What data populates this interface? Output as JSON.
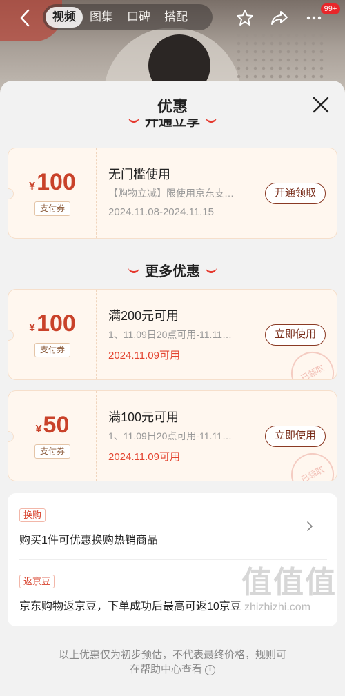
{
  "top_nav": {
    "tabs": [
      "视频",
      "图集",
      "口碑",
      "搭配"
    ],
    "active_tab": "视频",
    "badge": "99+"
  },
  "sheet": {
    "title": "优惠",
    "section_partial": "开通立享",
    "section_more": "更多优惠"
  },
  "coupons": [
    {
      "yen": "¥",
      "amount": "100",
      "type": "支付券",
      "title": "无门槛使用",
      "desc": "【购物立减】限使用京东支…",
      "date": "2024.11.08-2024.11.15",
      "button": "开通领取",
      "stamp": ""
    },
    {
      "yen": "¥",
      "amount": "100",
      "type": "支付券",
      "title": "满200元可用",
      "desc": "1、11.09日20点可用-11.11…",
      "date": "2024.11.09可用",
      "button": "立即使用",
      "stamp": "已领取"
    },
    {
      "yen": "¥",
      "amount": "50",
      "type": "支付券",
      "title": "满100元可用",
      "desc": "1、11.09日20点可用-11.11…",
      "date": "2024.11.09可用",
      "button": "立即使用",
      "stamp": "已领取"
    }
  ],
  "info": [
    {
      "tag": "换购",
      "text": "购买1件可优惠换购热销商品"
    },
    {
      "tag": "返京豆",
      "text": "京东购物返京豆，下单成功后最高可返10京豆"
    }
  ],
  "footer": {
    "line1": "以上优惠仅为初步预估，不代表最终价格，规则可",
    "line2": "在帮助中心查看",
    "info_glyph": "i"
  },
  "watermark": {
    "logo": "值值值",
    "domain": "zhizhizhi.com"
  },
  "colors": {
    "accent_red": "#e3432f",
    "coupon_bg": "#fff7ef",
    "button_brown": "#8a3a24"
  }
}
